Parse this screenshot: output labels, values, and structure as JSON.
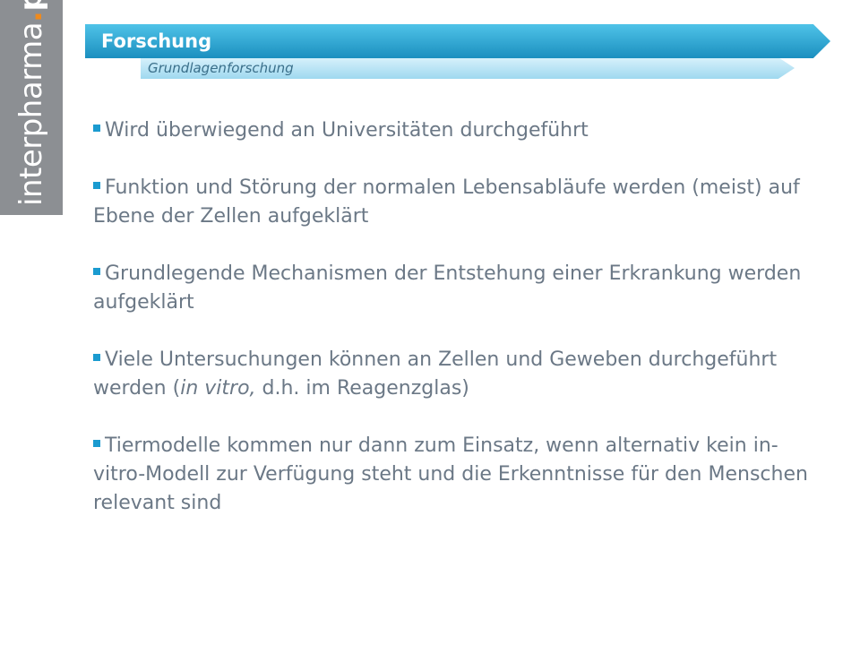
{
  "logo": {
    "thin": "interpharma",
    "dot": ".",
    "bold": "ph"
  },
  "header": {
    "title": "Forschung",
    "subtitle": "Grundlagenforschung"
  },
  "bullets": [
    {
      "text": "Wird überwiegend an Universitäten durchgeführt"
    },
    {
      "text": "Funktion und Störung der normalen Lebensabläufe werden (meist) auf Ebene der Zellen aufgeklärt"
    },
    {
      "text": "Grundlegende Mechanismen der Entstehung einer Erkrankung werden aufgeklärt"
    },
    {
      "text_before": "Viele Untersuchungen können an Zellen und Geweben durchgeführt werden (",
      "text_italic": "in vitro,",
      "text_after": " d.h. im Reagenzglas)"
    },
    {
      "text": "Tiermodelle kommen nur dann zum Einsatz, wenn alternativ kein in-vitro-Modell zur Verfügung steht und die Erkenntnisse für den Menschen relevant sind"
    }
  ],
  "colors": {
    "accent": "#1b9bd0",
    "text": "#6b7886",
    "logo_strip": "#8c8f93",
    "logo_dot": "#f08a1c"
  }
}
